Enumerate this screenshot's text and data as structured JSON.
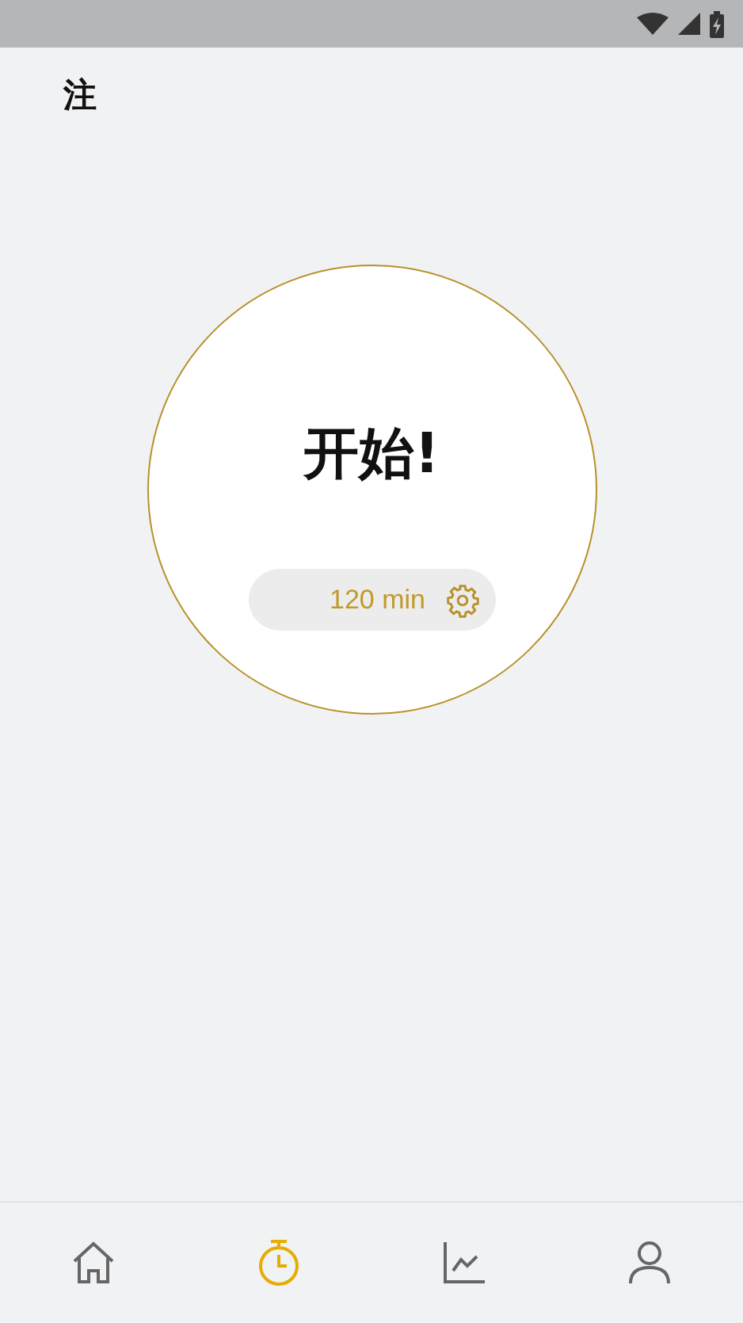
{
  "header": {
    "title": "注"
  },
  "timer": {
    "label": "开始!",
    "duration": "120 min"
  },
  "nav": [
    {
      "kind": "home",
      "selected": false
    },
    {
      "kind": "timer",
      "selected": true
    },
    {
      "kind": "stats",
      "selected": false
    },
    {
      "kind": "profile",
      "selected": false
    }
  ]
}
